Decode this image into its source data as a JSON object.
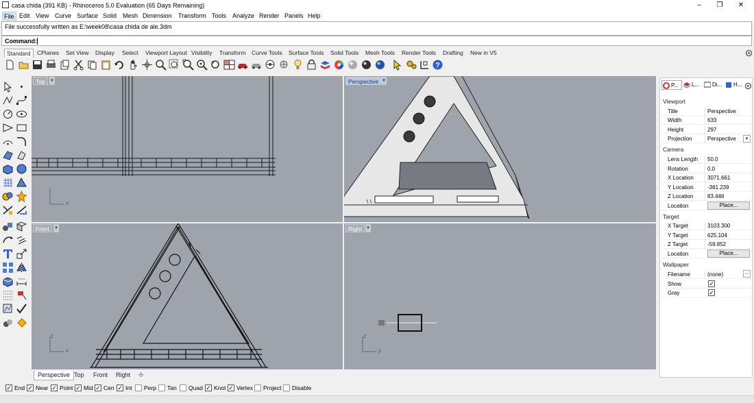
{
  "window": {
    "title": "casa chida (391 KB) - Rhinoceros 5.0 Evaluation (65 Days Remaining)",
    "minimize": "–",
    "maximize": "❐",
    "close": "✕"
  },
  "menus": [
    "File",
    "Edit",
    "View",
    "Curve",
    "Surface",
    "Solid",
    "Mesh",
    "Dimension",
    "Transform",
    "Tools",
    "Analyze",
    "Render",
    "Panels",
    "Help"
  ],
  "command": {
    "history": "File successfully written as E:\\week08\\casa chida de ale.3dm",
    "prompt_label": "Command:"
  },
  "toolbar_tabs": [
    "Standard",
    "CPlanes",
    "Set View",
    "Display",
    "Select",
    "Viewport Layout",
    "Visibility",
    "Transform",
    "Curve Tools",
    "Surface Tools",
    "Solid Tools",
    "Mesh Tools",
    "Render Tools",
    "Drafting",
    "New in V5"
  ],
  "viewports": {
    "top": "Top",
    "perspective": "Perspective",
    "front": "Front",
    "right": "Right"
  },
  "axis_labels": {
    "x": "x",
    "y": "y",
    "z": "z"
  },
  "viewport_tabs": [
    "Perspective",
    "Top",
    "Front",
    "Right"
  ],
  "panel": {
    "tabs": [
      "P...",
      "L...",
      "Di...",
      "H..."
    ],
    "sections": {
      "viewport": "Viewport",
      "camera": "Camera",
      "target": "Target",
      "wallpaper": "Wallpaper"
    },
    "rows": {
      "title": {
        "k": "Title",
        "v": "Perspective"
      },
      "width": {
        "k": "Width",
        "v": "633"
      },
      "height": {
        "k": "Height",
        "v": "297"
      },
      "projection": {
        "k": "Projection",
        "v": "Perspective"
      },
      "lens": {
        "k": "Lens Length",
        "v": "50.0"
      },
      "rotation": {
        "k": "Rotation",
        "v": "0.0"
      },
      "xloc": {
        "k": "X Location",
        "v": "3071.661"
      },
      "yloc": {
        "k": "Y Location",
        "v": "-381.239"
      },
      "zloc": {
        "k": "Z Location",
        "v": "83.446"
      },
      "loc": {
        "k": "Location",
        "v": "Place..."
      },
      "xt": {
        "k": "X Target",
        "v": "3103.300"
      },
      "yt": {
        "k": "Y Target",
        "v": "625.104"
      },
      "zt": {
        "k": "Z Target",
        "v": "-59.852"
      },
      "tloc": {
        "k": "Location",
        "v": "Place..."
      },
      "filename": {
        "k": "Filename",
        "v": "(none)"
      },
      "show": {
        "k": "Show",
        "v": "✓"
      },
      "gray": {
        "k": "Gray",
        "v": "✓"
      }
    },
    "browse": "..."
  },
  "osnaps": [
    "End",
    "Near",
    "Point",
    "Mid",
    "Cen",
    "Int",
    "Perp",
    "Tan",
    "Quad",
    "Knot",
    "Vertex",
    "Project",
    "Disable"
  ],
  "osnap_checked": [
    true,
    true,
    true,
    true,
    true,
    true,
    false,
    false,
    false,
    true,
    true,
    false,
    false
  ],
  "check_glyph": "✓"
}
